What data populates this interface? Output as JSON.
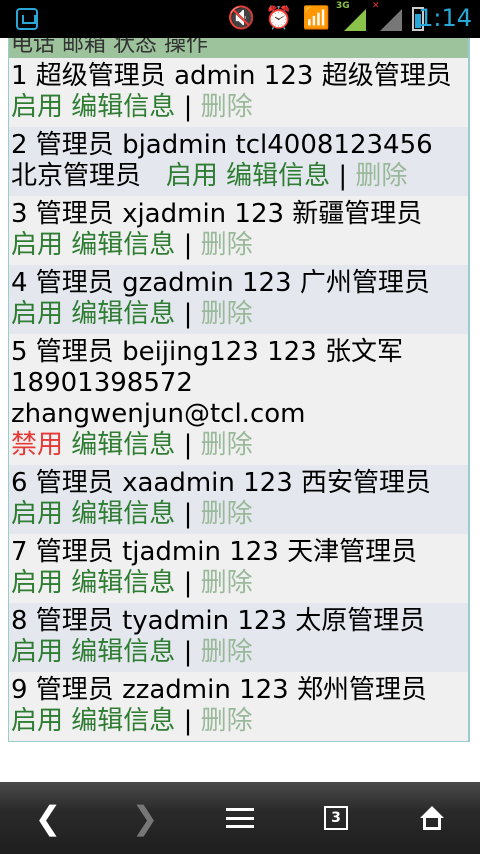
{
  "status_bar": {
    "time": "1:14",
    "network_tag": "3G",
    "second_sim_tag": "✕"
  },
  "table": {
    "header": "电话 邮箱 状态 操作",
    "rows": [
      {
        "line1": "1 超级管理员 admin 123 超级管理员",
        "line2": "",
        "line3": "",
        "status": "启用",
        "edit": "编辑信息",
        "sep": "|",
        "delete": "删除"
      },
      {
        "line1": "2 管理员 bjadmin tcl4008123456",
        "line2": "北京管理员",
        "line3": "",
        "status": "启用",
        "edit": "编辑信息",
        "sep": "|",
        "delete": "删除"
      },
      {
        "line1": "3 管理员 xjadmin 123 新疆管理员",
        "line2": "",
        "line3": "",
        "status": "启用",
        "edit": "编辑信息",
        "sep": "|",
        "delete": "删除"
      },
      {
        "line1": "4 管理员 gzadmin 123 广州管理员",
        "line2": "",
        "line3": "",
        "status": "启用",
        "edit": "编辑信息",
        "sep": "|",
        "delete": "删除"
      },
      {
        "line1": "5 管理员 beijing123 123 张文军",
        "line2": "18901398572",
        "line3": "zhangwenjun@tcl.com",
        "status": "禁用",
        "edit": "编辑信息",
        "sep": "|",
        "delete": "删除"
      },
      {
        "line1": "6 管理员 xaadmin 123 西安管理员",
        "line2": "",
        "line3": "",
        "status": "启用",
        "edit": "编辑信息",
        "sep": "|",
        "delete": "删除"
      },
      {
        "line1": "7 管理员 tjadmin 123 天津管理员",
        "line2": "",
        "line3": "",
        "status": "启用",
        "edit": "编辑信息",
        "sep": "|",
        "delete": "删除"
      },
      {
        "line1": "8 管理员 tyadmin 123 太原管理员",
        "line2": "",
        "line3": "",
        "status": "启用",
        "edit": "编辑信息",
        "sep": "|",
        "delete": "删除"
      },
      {
        "line1": "9 管理员 zzadmin 123 郑州管理员",
        "line2": "",
        "line3": "",
        "status": "启用",
        "edit": "编辑信息",
        "sep": "|",
        "delete": "删除"
      }
    ]
  },
  "nav_bar": {
    "tab_count": "3",
    "icons": [
      "back-icon",
      "forward-icon",
      "menu-icon",
      "tabs-icon",
      "home-icon"
    ]
  },
  "colors": {
    "enabled_link": "#2e7d32",
    "disabled_status": "#e53935",
    "deleted_link": "#9ab89a",
    "header_bg": "#9cc39c",
    "clock": "#29a8d8"
  }
}
